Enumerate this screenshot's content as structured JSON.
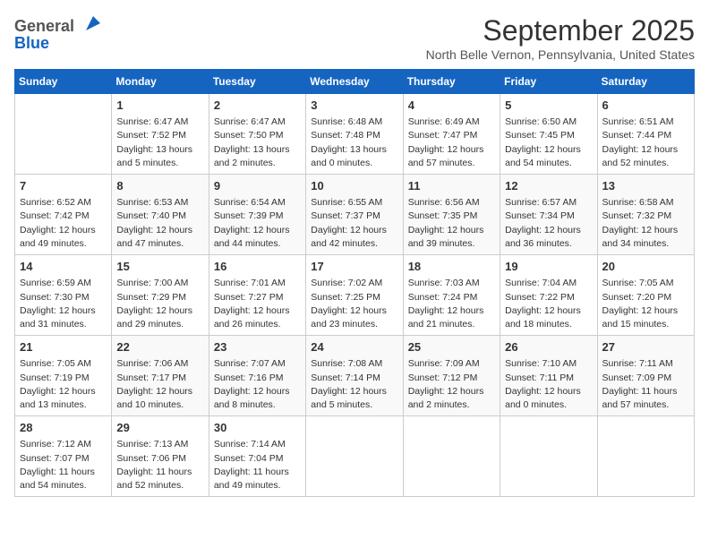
{
  "header": {
    "logo_general": "General",
    "logo_blue": "Blue",
    "title": "September 2025",
    "location": "North Belle Vernon, Pennsylvania, United States"
  },
  "columns": [
    "Sunday",
    "Monday",
    "Tuesday",
    "Wednesday",
    "Thursday",
    "Friday",
    "Saturday"
  ],
  "weeks": [
    [
      {
        "day": "",
        "info": ""
      },
      {
        "day": "1",
        "info": "Sunrise: 6:47 AM\nSunset: 7:52 PM\nDaylight: 13 hours\nand 5 minutes."
      },
      {
        "day": "2",
        "info": "Sunrise: 6:47 AM\nSunset: 7:50 PM\nDaylight: 13 hours\nand 2 minutes."
      },
      {
        "day": "3",
        "info": "Sunrise: 6:48 AM\nSunset: 7:48 PM\nDaylight: 13 hours\nand 0 minutes."
      },
      {
        "day": "4",
        "info": "Sunrise: 6:49 AM\nSunset: 7:47 PM\nDaylight: 12 hours\nand 57 minutes."
      },
      {
        "day": "5",
        "info": "Sunrise: 6:50 AM\nSunset: 7:45 PM\nDaylight: 12 hours\nand 54 minutes."
      },
      {
        "day": "6",
        "info": "Sunrise: 6:51 AM\nSunset: 7:44 PM\nDaylight: 12 hours\nand 52 minutes."
      }
    ],
    [
      {
        "day": "7",
        "info": "Sunrise: 6:52 AM\nSunset: 7:42 PM\nDaylight: 12 hours\nand 49 minutes."
      },
      {
        "day": "8",
        "info": "Sunrise: 6:53 AM\nSunset: 7:40 PM\nDaylight: 12 hours\nand 47 minutes."
      },
      {
        "day": "9",
        "info": "Sunrise: 6:54 AM\nSunset: 7:39 PM\nDaylight: 12 hours\nand 44 minutes."
      },
      {
        "day": "10",
        "info": "Sunrise: 6:55 AM\nSunset: 7:37 PM\nDaylight: 12 hours\nand 42 minutes."
      },
      {
        "day": "11",
        "info": "Sunrise: 6:56 AM\nSunset: 7:35 PM\nDaylight: 12 hours\nand 39 minutes."
      },
      {
        "day": "12",
        "info": "Sunrise: 6:57 AM\nSunset: 7:34 PM\nDaylight: 12 hours\nand 36 minutes."
      },
      {
        "day": "13",
        "info": "Sunrise: 6:58 AM\nSunset: 7:32 PM\nDaylight: 12 hours\nand 34 minutes."
      }
    ],
    [
      {
        "day": "14",
        "info": "Sunrise: 6:59 AM\nSunset: 7:30 PM\nDaylight: 12 hours\nand 31 minutes."
      },
      {
        "day": "15",
        "info": "Sunrise: 7:00 AM\nSunset: 7:29 PM\nDaylight: 12 hours\nand 29 minutes."
      },
      {
        "day": "16",
        "info": "Sunrise: 7:01 AM\nSunset: 7:27 PM\nDaylight: 12 hours\nand 26 minutes."
      },
      {
        "day": "17",
        "info": "Sunrise: 7:02 AM\nSunset: 7:25 PM\nDaylight: 12 hours\nand 23 minutes."
      },
      {
        "day": "18",
        "info": "Sunrise: 7:03 AM\nSunset: 7:24 PM\nDaylight: 12 hours\nand 21 minutes."
      },
      {
        "day": "19",
        "info": "Sunrise: 7:04 AM\nSunset: 7:22 PM\nDaylight: 12 hours\nand 18 minutes."
      },
      {
        "day": "20",
        "info": "Sunrise: 7:05 AM\nSunset: 7:20 PM\nDaylight: 12 hours\nand 15 minutes."
      }
    ],
    [
      {
        "day": "21",
        "info": "Sunrise: 7:05 AM\nSunset: 7:19 PM\nDaylight: 12 hours\nand 13 minutes."
      },
      {
        "day": "22",
        "info": "Sunrise: 7:06 AM\nSunset: 7:17 PM\nDaylight: 12 hours\nand 10 minutes."
      },
      {
        "day": "23",
        "info": "Sunrise: 7:07 AM\nSunset: 7:16 PM\nDaylight: 12 hours\nand 8 minutes."
      },
      {
        "day": "24",
        "info": "Sunrise: 7:08 AM\nSunset: 7:14 PM\nDaylight: 12 hours\nand 5 minutes."
      },
      {
        "day": "25",
        "info": "Sunrise: 7:09 AM\nSunset: 7:12 PM\nDaylight: 12 hours\nand 2 minutes."
      },
      {
        "day": "26",
        "info": "Sunrise: 7:10 AM\nSunset: 7:11 PM\nDaylight: 12 hours\nand 0 minutes."
      },
      {
        "day": "27",
        "info": "Sunrise: 7:11 AM\nSunset: 7:09 PM\nDaylight: 11 hours\nand 57 minutes."
      }
    ],
    [
      {
        "day": "28",
        "info": "Sunrise: 7:12 AM\nSunset: 7:07 PM\nDaylight: 11 hours\nand 54 minutes."
      },
      {
        "day": "29",
        "info": "Sunrise: 7:13 AM\nSunset: 7:06 PM\nDaylight: 11 hours\nand 52 minutes."
      },
      {
        "day": "30",
        "info": "Sunrise: 7:14 AM\nSunset: 7:04 PM\nDaylight: 11 hours\nand 49 minutes."
      },
      {
        "day": "",
        "info": ""
      },
      {
        "day": "",
        "info": ""
      },
      {
        "day": "",
        "info": ""
      },
      {
        "day": "",
        "info": ""
      }
    ]
  ]
}
